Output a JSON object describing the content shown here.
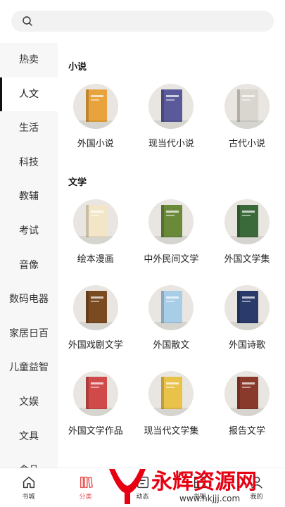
{
  "search": {
    "placeholder": ""
  },
  "sidebar": {
    "items": [
      {
        "label": "热卖",
        "active": false
      },
      {
        "label": "人文",
        "active": true
      },
      {
        "label": "生活",
        "active": false
      },
      {
        "label": "科技",
        "active": false
      },
      {
        "label": "教辅",
        "active": false
      },
      {
        "label": "考试",
        "active": false
      },
      {
        "label": "音像",
        "active": false
      },
      {
        "label": "数码电器",
        "active": false
      },
      {
        "label": "家居日百",
        "active": false
      },
      {
        "label": "儿童益智",
        "active": false
      },
      {
        "label": "文娱",
        "active": false
      },
      {
        "label": "文具",
        "active": false
      },
      {
        "label": "食品",
        "active": false
      }
    ]
  },
  "sections": [
    {
      "title": "小说",
      "items": [
        {
          "label": "外国小说",
          "color": "#e8a33c"
        },
        {
          "label": "现当代小说",
          "color": "#5a5a9a"
        },
        {
          "label": "古代小说",
          "color": "#d9d6cf"
        }
      ]
    },
    {
      "title": "文学",
      "items": [
        {
          "label": "绘本漫画",
          "color": "#f3e6c8"
        },
        {
          "label": "中外民间文学",
          "color": "#6a8a3a"
        },
        {
          "label": "外国文学集",
          "color": "#3a6a3a"
        },
        {
          "label": "外国戏剧文学",
          "color": "#7a4a20"
        },
        {
          "label": "外国散文",
          "color": "#a8cde6"
        },
        {
          "label": "外国诗歌",
          "color": "#2a3a6a"
        },
        {
          "label": "外国文学作品",
          "color": "#d14a4a"
        },
        {
          "label": "现当代文学集",
          "color": "#e9c24a"
        },
        {
          "label": "报告文学",
          "color": "#8a3a2a"
        }
      ]
    }
  ],
  "tabbar": {
    "tabs": [
      {
        "label": "书城",
        "icon": "home-icon",
        "active": false
      },
      {
        "label": "分类",
        "icon": "books-icon",
        "active": true
      },
      {
        "label": "动态",
        "icon": "feed-icon",
        "active": false
      },
      {
        "label": "书架",
        "icon": "shelf-icon",
        "active": false
      },
      {
        "label": "我的",
        "icon": "user-icon",
        "active": false
      }
    ]
  },
  "watermark": {
    "title": "永辉资源网",
    "url": "www.hkjjj.com",
    "accent": "#e60012"
  },
  "colors": {
    "accent": "#e45454",
    "sidebar_bg": "#f7f7f7"
  }
}
